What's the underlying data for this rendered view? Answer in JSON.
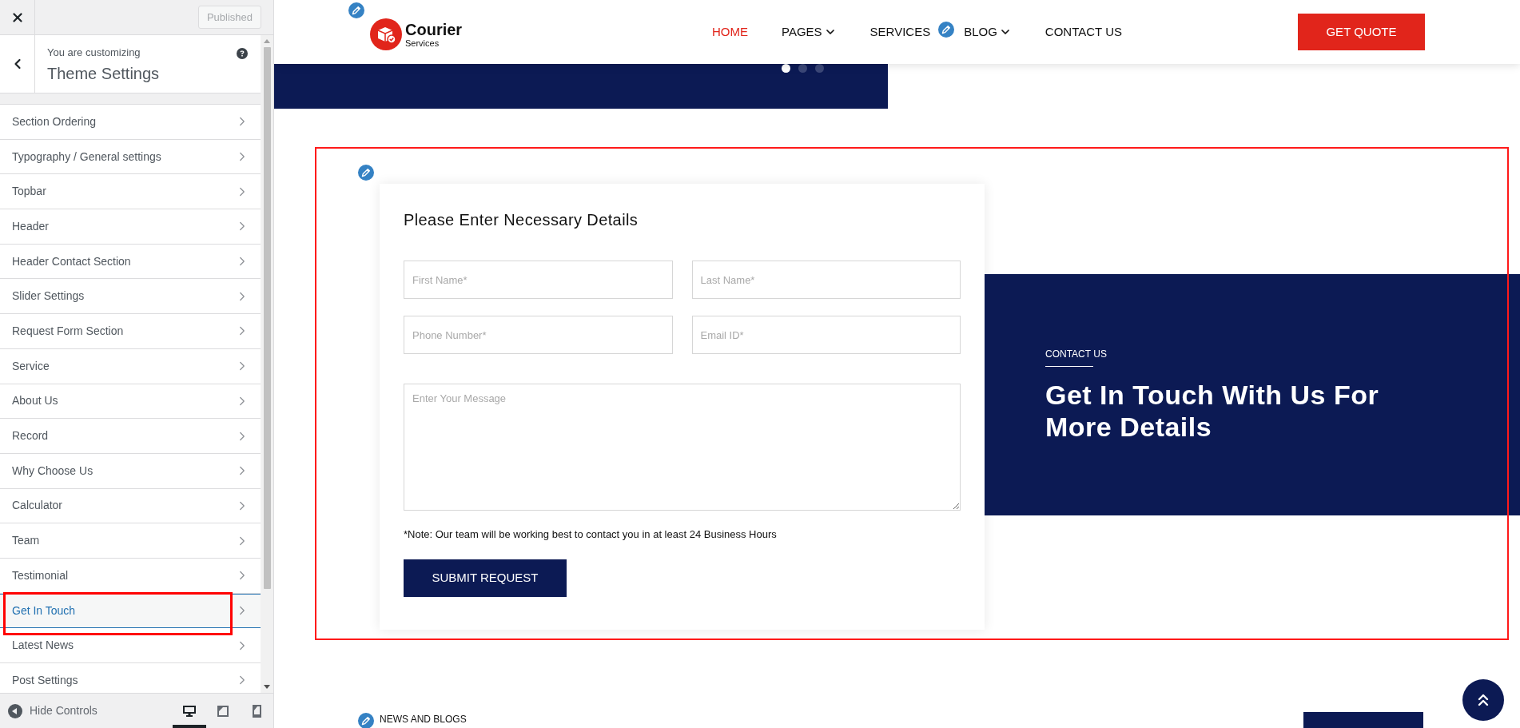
{
  "customizer": {
    "publish_button": {
      "label": "Published",
      "disabled": true
    },
    "header": {
      "caption": "You are customizing",
      "title": "Theme Settings"
    },
    "sections": [
      {
        "label": "Section Ordering",
        "selected": false,
        "highlighted": false
      },
      {
        "label": "Typography / General settings",
        "selected": false,
        "highlighted": false
      },
      {
        "label": "Topbar",
        "selected": false,
        "highlighted": false
      },
      {
        "label": "Header",
        "selected": false,
        "highlighted": false
      },
      {
        "label": "Header Contact Section",
        "selected": false,
        "highlighted": false
      },
      {
        "label": "Slider Settings",
        "selected": false,
        "highlighted": false
      },
      {
        "label": "Request Form Section",
        "selected": false,
        "highlighted": false
      },
      {
        "label": "Service",
        "selected": false,
        "highlighted": false
      },
      {
        "label": "About Us",
        "selected": false,
        "highlighted": false
      },
      {
        "label": "Record",
        "selected": false,
        "highlighted": false
      },
      {
        "label": "Why Choose Us",
        "selected": false,
        "highlighted": false
      },
      {
        "label": "Calculator",
        "selected": false,
        "highlighted": false
      },
      {
        "label": "Team",
        "selected": false,
        "highlighted": false
      },
      {
        "label": "Testimonial",
        "selected": false,
        "highlighted": false
      },
      {
        "label": "Get In Touch",
        "selected": true,
        "highlighted": true
      },
      {
        "label": "Latest News",
        "selected": false,
        "highlighted": false
      },
      {
        "label": "Post Settings",
        "selected": false,
        "highlighted": false
      }
    ],
    "footer": {
      "hide_label": "Hide Controls",
      "devices": [
        {
          "kind": "desktop",
          "selected": true
        },
        {
          "kind": "tablet",
          "selected": false
        },
        {
          "kind": "mobile",
          "selected": false
        }
      ]
    }
  },
  "preview": {
    "logo": {
      "name": "Courier",
      "tagline": "Services"
    },
    "nav": [
      {
        "label": "HOME",
        "selected": true,
        "has_menu": false
      },
      {
        "label": "PAGES",
        "selected": false,
        "has_menu": true
      },
      {
        "label": "SERVICES",
        "selected": false,
        "has_menu": false
      },
      {
        "label": "BLOG",
        "selected": false,
        "has_menu": true
      },
      {
        "label": "CONTACT US",
        "selected": false,
        "has_menu": false
      }
    ],
    "quote_button": "GET QUOTE",
    "slider_dots": [
      {
        "selected": true
      },
      {
        "selected": false
      },
      {
        "selected": false
      }
    ],
    "request_form": {
      "highlighted": true,
      "title": "Please Enter Necessary Details",
      "fields": [
        {
          "kind": "input",
          "placeholder": "First Name*"
        },
        {
          "kind": "input",
          "placeholder": "Last Name*"
        },
        {
          "kind": "input",
          "placeholder": "Phone Number*"
        },
        {
          "kind": "input",
          "placeholder": "Email ID*"
        },
        {
          "kind": "textarea",
          "placeholder": "Enter Your Message"
        }
      ],
      "note": "*Note: Our team will be working best to contact you in at least 24 Business Hours",
      "submit_button": "SUBMIT REQUEST"
    },
    "contact": {
      "eyebrow": "CONTACT US",
      "heading": "Get In Touch With Us For More Details"
    },
    "news": {
      "eyebrow": "NEWS AND BLOGS"
    }
  }
}
